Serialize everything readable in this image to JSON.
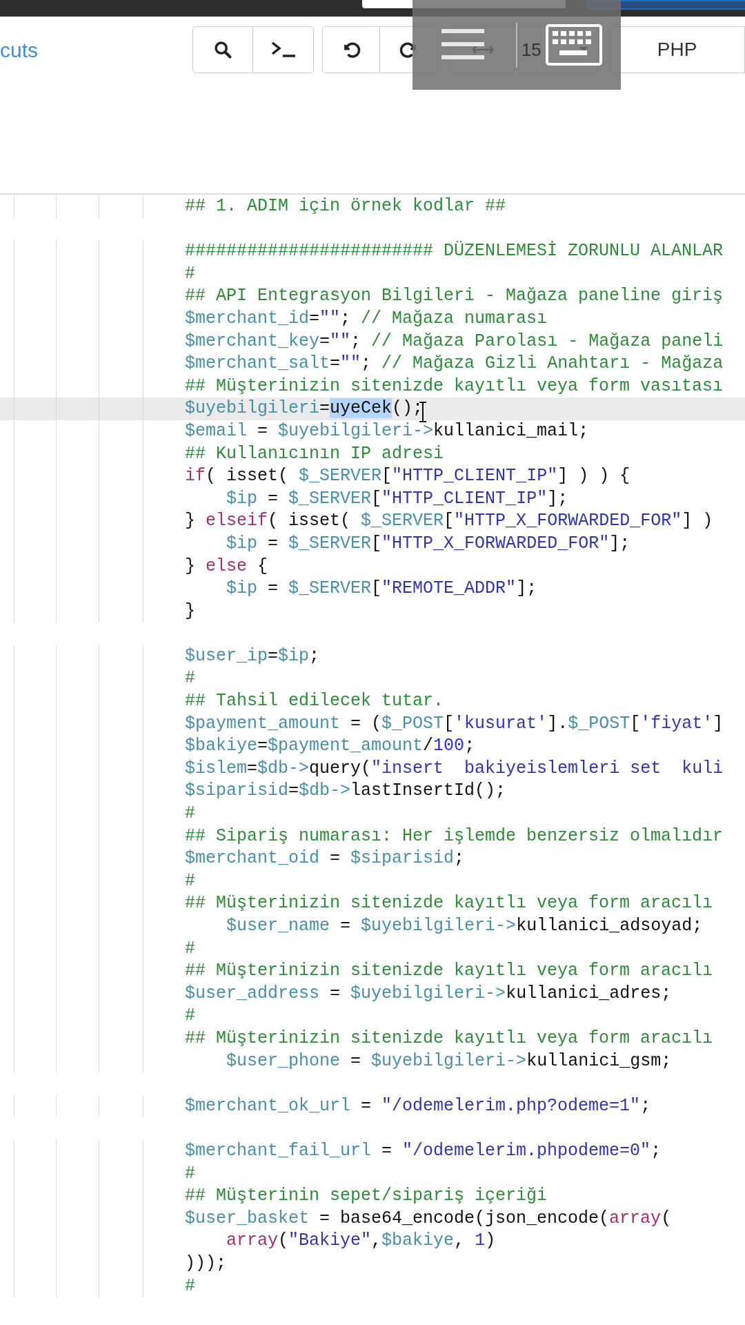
{
  "toolbar": {
    "link": "cuts",
    "font_size": "15",
    "mode": "PHP"
  },
  "editor": {
    "lines": [
      {
        "kind": "code",
        "text": "## 1. ADIM için örnek kodlar ##",
        "active": false
      },
      {
        "kind": "blank"
      },
      {
        "kind": "code",
        "text": "######################## DÜZENLEMESİ ZORUNLU ALANLAR",
        "active": false
      },
      {
        "kind": "code",
        "text": "#",
        "active": false
      },
      {
        "kind": "code",
        "text": "## API Entegrasyon Bilgileri - Mağaza paneline giriş",
        "active": false
      },
      {
        "kind": "code",
        "text": "$merchant_id=\"\"; // Mağaza numarası",
        "active": false
      },
      {
        "kind": "code",
        "text": "$merchant_key=\"\"; // Mağaza Parolası - Mağaza paneli",
        "active": false
      },
      {
        "kind": "code",
        "text": "$merchant_salt=\"\"; // Mağaza Gizli Anahtarı - Mağaza",
        "active": false
      },
      {
        "kind": "code",
        "text": "## Müşterinizin sitenizde kayıtlı veya form vasıtası",
        "active": false
      },
      {
        "kind": "code",
        "parts": [
          {
            "text": "$uyebilgileri=",
            "selected": false
          },
          {
            "text": "uyeCek",
            "selected": true
          },
          {
            "text": "();",
            "selected": false
          }
        ],
        "active": true
      },
      {
        "kind": "code",
        "text": "$email = $uyebilgileri->kullanici_mail;",
        "active": false
      },
      {
        "kind": "code",
        "text": "## Kullanıcının IP adresi",
        "active": false
      },
      {
        "kind": "code",
        "text": "if( isset( $_SERVER[\"HTTP_CLIENT_IP\"] ) ) {",
        "active": false
      },
      {
        "kind": "code",
        "text": "    $ip = $_SERVER[\"HTTP_CLIENT_IP\"];",
        "active": false
      },
      {
        "kind": "code",
        "text": "} elseif( isset( $_SERVER[\"HTTP_X_FORWARDED_FOR\"] )",
        "active": false
      },
      {
        "kind": "code",
        "text": "    $ip = $_SERVER[\"HTTP_X_FORWARDED_FOR\"];",
        "active": false
      },
      {
        "kind": "code",
        "text": "} else {",
        "active": false
      },
      {
        "kind": "code",
        "text": "    $ip = $_SERVER[\"REMOTE_ADDR\"];",
        "active": false
      },
      {
        "kind": "code",
        "text": "}",
        "active": false
      },
      {
        "kind": "blank"
      },
      {
        "kind": "code",
        "text": "$user_ip=$ip;",
        "active": false
      },
      {
        "kind": "code",
        "text": "#",
        "active": false
      },
      {
        "kind": "code",
        "text": "## Tahsil edilecek tutar.",
        "active": false
      },
      {
        "kind": "code",
        "text": "$payment_amount = ($_POST['kusurat'].$_POST['fiyat']",
        "active": false
      },
      {
        "kind": "code",
        "text": "$bakiye=$payment_amount/100;",
        "active": false
      },
      {
        "kind": "code",
        "text": "$islem=$db->query(\"insert  bakiyeislemleri set  kuli",
        "active": false
      },
      {
        "kind": "code",
        "text": "$siparisid=$db->lastInsertId();",
        "active": false
      },
      {
        "kind": "code",
        "text": "#",
        "active": false
      },
      {
        "kind": "code",
        "text": "## Sipariş numarası: Her işlemde benzersiz olmalıdır",
        "active": false
      },
      {
        "kind": "code",
        "text": "$merchant_oid = $siparisid;",
        "active": false
      },
      {
        "kind": "code",
        "text": "#",
        "active": false
      },
      {
        "kind": "code",
        "text": "## Müşterinizin sitenizde kayıtlı veya form aracılı",
        "active": false
      },
      {
        "kind": "code",
        "text": "    $user_name = $uyebilgileri->kullanici_adsoyad;",
        "active": false
      },
      {
        "kind": "code",
        "text": "#",
        "active": false
      },
      {
        "kind": "code",
        "text": "## Müşterinizin sitenizde kayıtlı veya form aracılı",
        "active": false
      },
      {
        "kind": "code",
        "text": "$user_address = $uyebilgileri->kullanici_adres;",
        "active": false
      },
      {
        "kind": "code",
        "text": "#",
        "active": false
      },
      {
        "kind": "code",
        "text": "## Müşterinizin sitenizde kayıtlı veya form aracılı",
        "active": false
      },
      {
        "kind": "code",
        "text": "    $user_phone = $uyebilgileri->kullanici_gsm;",
        "active": false
      },
      {
        "kind": "blank"
      },
      {
        "kind": "code",
        "text": "$merchant_ok_url = \"/odemelerim.php?odeme=1\";",
        "active": false
      },
      {
        "kind": "blank"
      },
      {
        "kind": "code",
        "text": "$merchant_fail_url = \"/odemelerim.phpodeme=0\";",
        "active": false
      },
      {
        "kind": "code",
        "text": "#",
        "active": false
      },
      {
        "kind": "code",
        "text": "## Müşterinin sepet/sipariş içeriği",
        "active": false
      },
      {
        "kind": "code",
        "text": "$user_basket = base64_encode(json_encode(array(",
        "active": false
      },
      {
        "kind": "code",
        "text": "    array(\"Bakiye\",$bakiye, 1)",
        "active": false
      },
      {
        "kind": "code",
        "text": ")));",
        "active": false
      },
      {
        "kind": "code",
        "text": "#",
        "active": false
      },
      {
        "kind": "blank"
      }
    ]
  }
}
